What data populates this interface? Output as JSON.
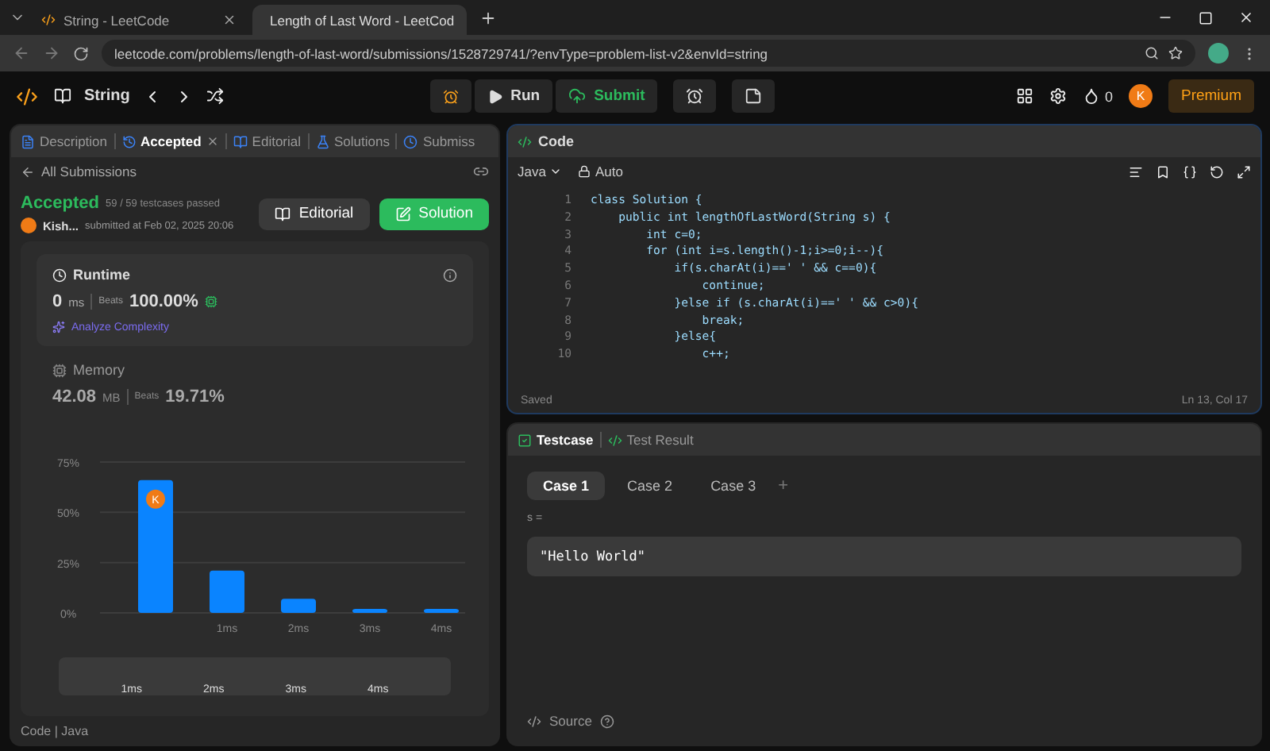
{
  "browser": {
    "tabs": [
      {
        "title": "String - LeetCode",
        "selected": false
      },
      {
        "title": "Length of Last Word - LeetCod",
        "selected": true
      }
    ],
    "url": "leetcode.com/problems/length-of-last-word/submissions/1528729741/?envType=problem-list-v2&envId=string"
  },
  "header": {
    "problem_list": "String",
    "run": "Run",
    "submit": "Submit",
    "streak": "0",
    "avatar": "K",
    "premium": "Premium"
  },
  "left_panel": {
    "tabs": [
      {
        "label": "Description",
        "selected": false,
        "closable": false
      },
      {
        "label": "Accepted",
        "selected": true,
        "closable": true
      },
      {
        "label": "Editorial",
        "selected": false,
        "closable": false
      },
      {
        "label": "Solutions",
        "selected": false,
        "closable": false
      },
      {
        "label": "Submiss",
        "selected": false,
        "closable": false
      }
    ],
    "back": "All Submissions",
    "status": "Accepted",
    "tests": "59 / 59 testcases passed",
    "user": "Kish...",
    "submitted": "submitted at Feb 02, 2025 20:06",
    "buttons": [
      "Editorial",
      "Solution"
    ],
    "runtime": {
      "title": "Runtime",
      "value": "0",
      "unit": "ms",
      "beats_label": "Beats",
      "beats": "100.00%",
      "analyze": "Analyze Complexity"
    },
    "memory": {
      "title": "Memory",
      "value": "42.08",
      "unit": "MB",
      "beats_label": "Beats",
      "beats": "19.71%",
      "marker": "K",
      "chart_data": {
        "type": "bar",
        "categories": [
          null,
          "1ms",
          "2ms",
          "3ms",
          "4ms"
        ],
        "values": [
          66,
          21,
          7,
          2,
          2
        ],
        "ylim": [
          0,
          75
        ],
        "yticks": [
          {
            "value": 0,
            "label": "0%"
          },
          {
            "value": 25,
            "label": "25%"
          },
          {
            "value": 50,
            "label": "50%"
          },
          {
            "value": 75,
            "label": "75%"
          }
        ]
      },
      "overview_labels": [
        "1ms",
        "2ms",
        "3ms",
        "4ms"
      ]
    },
    "footer": "Code | Java"
  },
  "code_panel": {
    "title": "Code",
    "language": "Java",
    "mode": "Auto",
    "lines": [
      {
        "number": "1",
        "text": "class Solution {"
      },
      {
        "number": "2",
        "text": "    public int lengthOfLastWord(String s) {"
      },
      {
        "number": "3",
        "text": "        int c=0;"
      },
      {
        "number": "4",
        "text": "        for (int i=s.length()-1;i>=0;i--){"
      },
      {
        "number": "5",
        "text": "            if(s.charAt(i)==' ' && c==0){"
      },
      {
        "number": "6",
        "text": "                continue;"
      },
      {
        "number": "7",
        "text": "            }else if (s.charAt(i)==' ' && c>0){"
      },
      {
        "number": "8",
        "text": "                break;"
      },
      {
        "number": "9",
        "text": "            }else{"
      },
      {
        "number": "10",
        "text": "                c++;"
      }
    ],
    "status": "Saved",
    "cursor": "Ln 13, Col 17"
  },
  "test_panel": {
    "tabs": [
      {
        "label": "Testcase",
        "selected": true
      },
      {
        "label": "Test Result",
        "selected": false
      }
    ],
    "cases": [
      {
        "label": "Case 1",
        "selected": true
      },
      {
        "label": "Case 2",
        "selected": false
      },
      {
        "label": "Case 3",
        "selected": false
      }
    ],
    "add": "+",
    "variable": "s =",
    "value": "\"Hello World\"",
    "source": "Source"
  }
}
